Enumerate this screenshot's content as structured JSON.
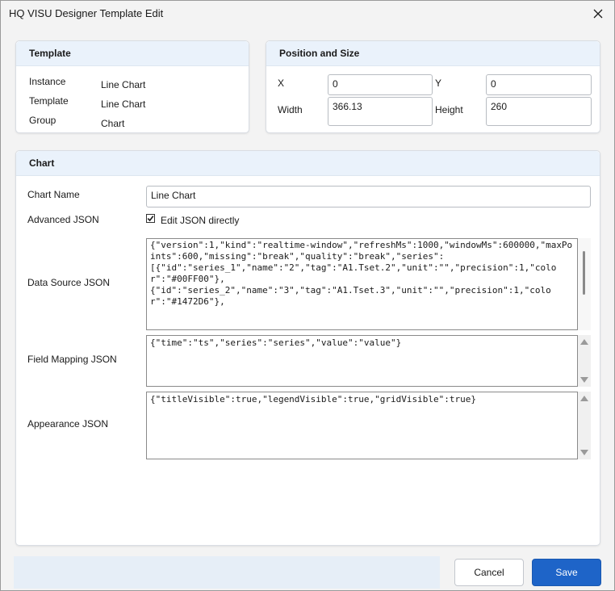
{
  "window": {
    "title": "HQ VISU Designer Template Edit",
    "close_icon": "close-icon"
  },
  "template_panel": {
    "header": "Template",
    "instance_label": "Instance",
    "instance_value": "Line Chart",
    "template_label": "Template",
    "template_value": "Line Chart",
    "group_label": "Group",
    "group_value": "Chart"
  },
  "position_panel": {
    "header": "Position and Size",
    "x_label": "X",
    "x_value": "0",
    "y_label": "Y",
    "y_value": "0",
    "width_label": "Width",
    "width_value": "366.13",
    "height_label": "Height",
    "height_value": "260"
  },
  "chart_panel": {
    "header": "Chart",
    "chart_name_label": "Chart Name",
    "chart_name_value": "Line Chart",
    "advanced_json_label": "Advanced JSON",
    "edit_json_label": "Edit JSON directly",
    "edit_json_checked": true,
    "data_source_label": "Data Source JSON",
    "data_source_value": "{\"version\":1,\"kind\":\"realtime-window\",\"refreshMs\":1000,\"windowMs\":600000,\"maxPoints\":600,\"missing\":\"break\",\"quality\":\"break\",\"series\":\n[{\"id\":\"series_1\",\"name\":\"2\",\"tag\":\"A1.Tset.2\",\"unit\":\"\",\"precision\":1,\"color\":\"#00FF00\"},\n{\"id\":\"series_2\",\"name\":\"3\",\"tag\":\"A1.Tset.3\",\"unit\":\"\",\"precision\":1,\"color\":\"#1472D6\"},",
    "field_mapping_label": "Field Mapping JSON",
    "field_mapping_value": "{\"time\":\"ts\",\"series\":\"series\",\"value\":\"value\"}",
    "appearance_label": "Appearance JSON",
    "appearance_value": "{\"titleVisible\":true,\"legendVisible\":true,\"gridVisible\":true}"
  },
  "footer": {
    "cancel_label": "Cancel",
    "save_label": "Save"
  },
  "colors": {
    "accent": "#1e64c8",
    "panel_header": "#eaf2fb",
    "background": "#f3f3f3"
  }
}
